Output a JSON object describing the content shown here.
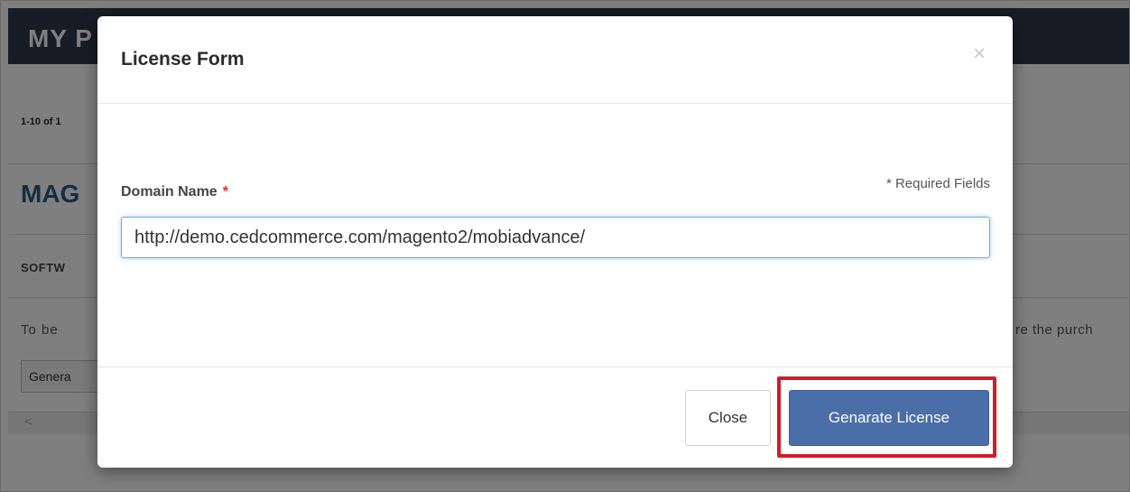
{
  "background": {
    "header_title": "MY P",
    "pagination": "1-10 of 1",
    "product_title": "MAG",
    "section_title": "SOFTW",
    "note_left": "To be",
    "note_right": "re the purch",
    "select_value": "Genera",
    "scroll_arrow": "<"
  },
  "modal": {
    "title": "License Form",
    "close_symbol": "×",
    "field_label": "Domain Name",
    "required_star": "*",
    "required_note": "* Required Fields",
    "domain_value": "http://demo.cedcommerce.com/magento2/mobiadvance/",
    "close_button": "Close",
    "primary_button": "Genarate License"
  },
  "colors": {
    "header_bg": "#2f3b4c",
    "primary_button": "#4a6ea8",
    "highlight_border": "#cc1f28",
    "required_star": "#e0302a"
  }
}
